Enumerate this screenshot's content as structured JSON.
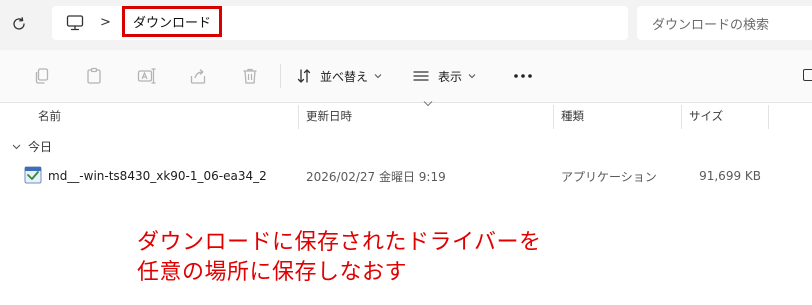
{
  "address_bar": {
    "location_icon": "this-pc-icon",
    "breadcrumb_separator": ">",
    "current_folder": "ダウンロード",
    "search_placeholder": "ダウンロードの検索"
  },
  "toolbar": {
    "icons": [
      "copy-icon",
      "paste-icon",
      "rename-icon",
      "share-icon",
      "delete-icon"
    ],
    "sort_label": "並べ替え",
    "view_label": "表示",
    "more_icon": "more-icon"
  },
  "columns": {
    "name": "名前",
    "modified": "更新日時",
    "type": "種類",
    "size": "サイズ"
  },
  "groups": [
    {
      "label": "今日",
      "files": [
        {
          "name": "md__-win-ts8430_xk90-1_06-ea34_2",
          "modified": "2026/02/27 金曜日 9:19",
          "type": "アプリケーション",
          "size": "91,699 KB",
          "icon": "installer-app-icon"
        }
      ]
    }
  ],
  "annotation": {
    "line1": "ダウンロードに保存されたドライバーを",
    "line2": "任意の場所に保存しなおす"
  },
  "colors": {
    "highlight_border": "#d90000",
    "annotation_text": "#e00000"
  }
}
